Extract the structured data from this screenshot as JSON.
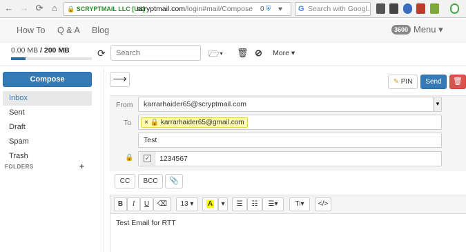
{
  "browser": {
    "secure_label": "SCRYPTMAIL LLC [US]",
    "url_host": "scryptmail.com",
    "url_path": "/login#mail/Compose",
    "url_badge": "0",
    "search_placeholder": "Search with Googl..."
  },
  "header": {
    "nav": [
      "How To",
      "Q & A",
      "Blog"
    ],
    "badge": "3600",
    "menu_label": "Menu ▾"
  },
  "toolbar": {
    "storage_used": "0.00 MB",
    "storage_total": "/ 200 MB",
    "storage_fraction": 0.0,
    "search_placeholder": "Search",
    "more_label": "More ▾"
  },
  "sidebar": {
    "compose_label": "Compose",
    "folders": [
      "Inbox",
      "Sent",
      "Draft",
      "Spam",
      "Trash"
    ],
    "active_folder": "Inbox",
    "folders_label": "FOLDERS"
  },
  "compose": {
    "pin_label": "PIN",
    "send_label": "Send",
    "from_label": "From",
    "from_value": "karrarhaider65@scryptmail.com",
    "to_label": "To",
    "to_token": "karrarhaider65@gmail.com",
    "subject_value": "Test",
    "pin_value": "1234567",
    "cc_label": "CC",
    "bcc_label": "BCC",
    "font_size": "13",
    "body_text": "Test Email for RTT"
  },
  "colors": {
    "primary": "#337ab7",
    "danger": "#d9534f",
    "token_bg": "#fffbb0"
  }
}
